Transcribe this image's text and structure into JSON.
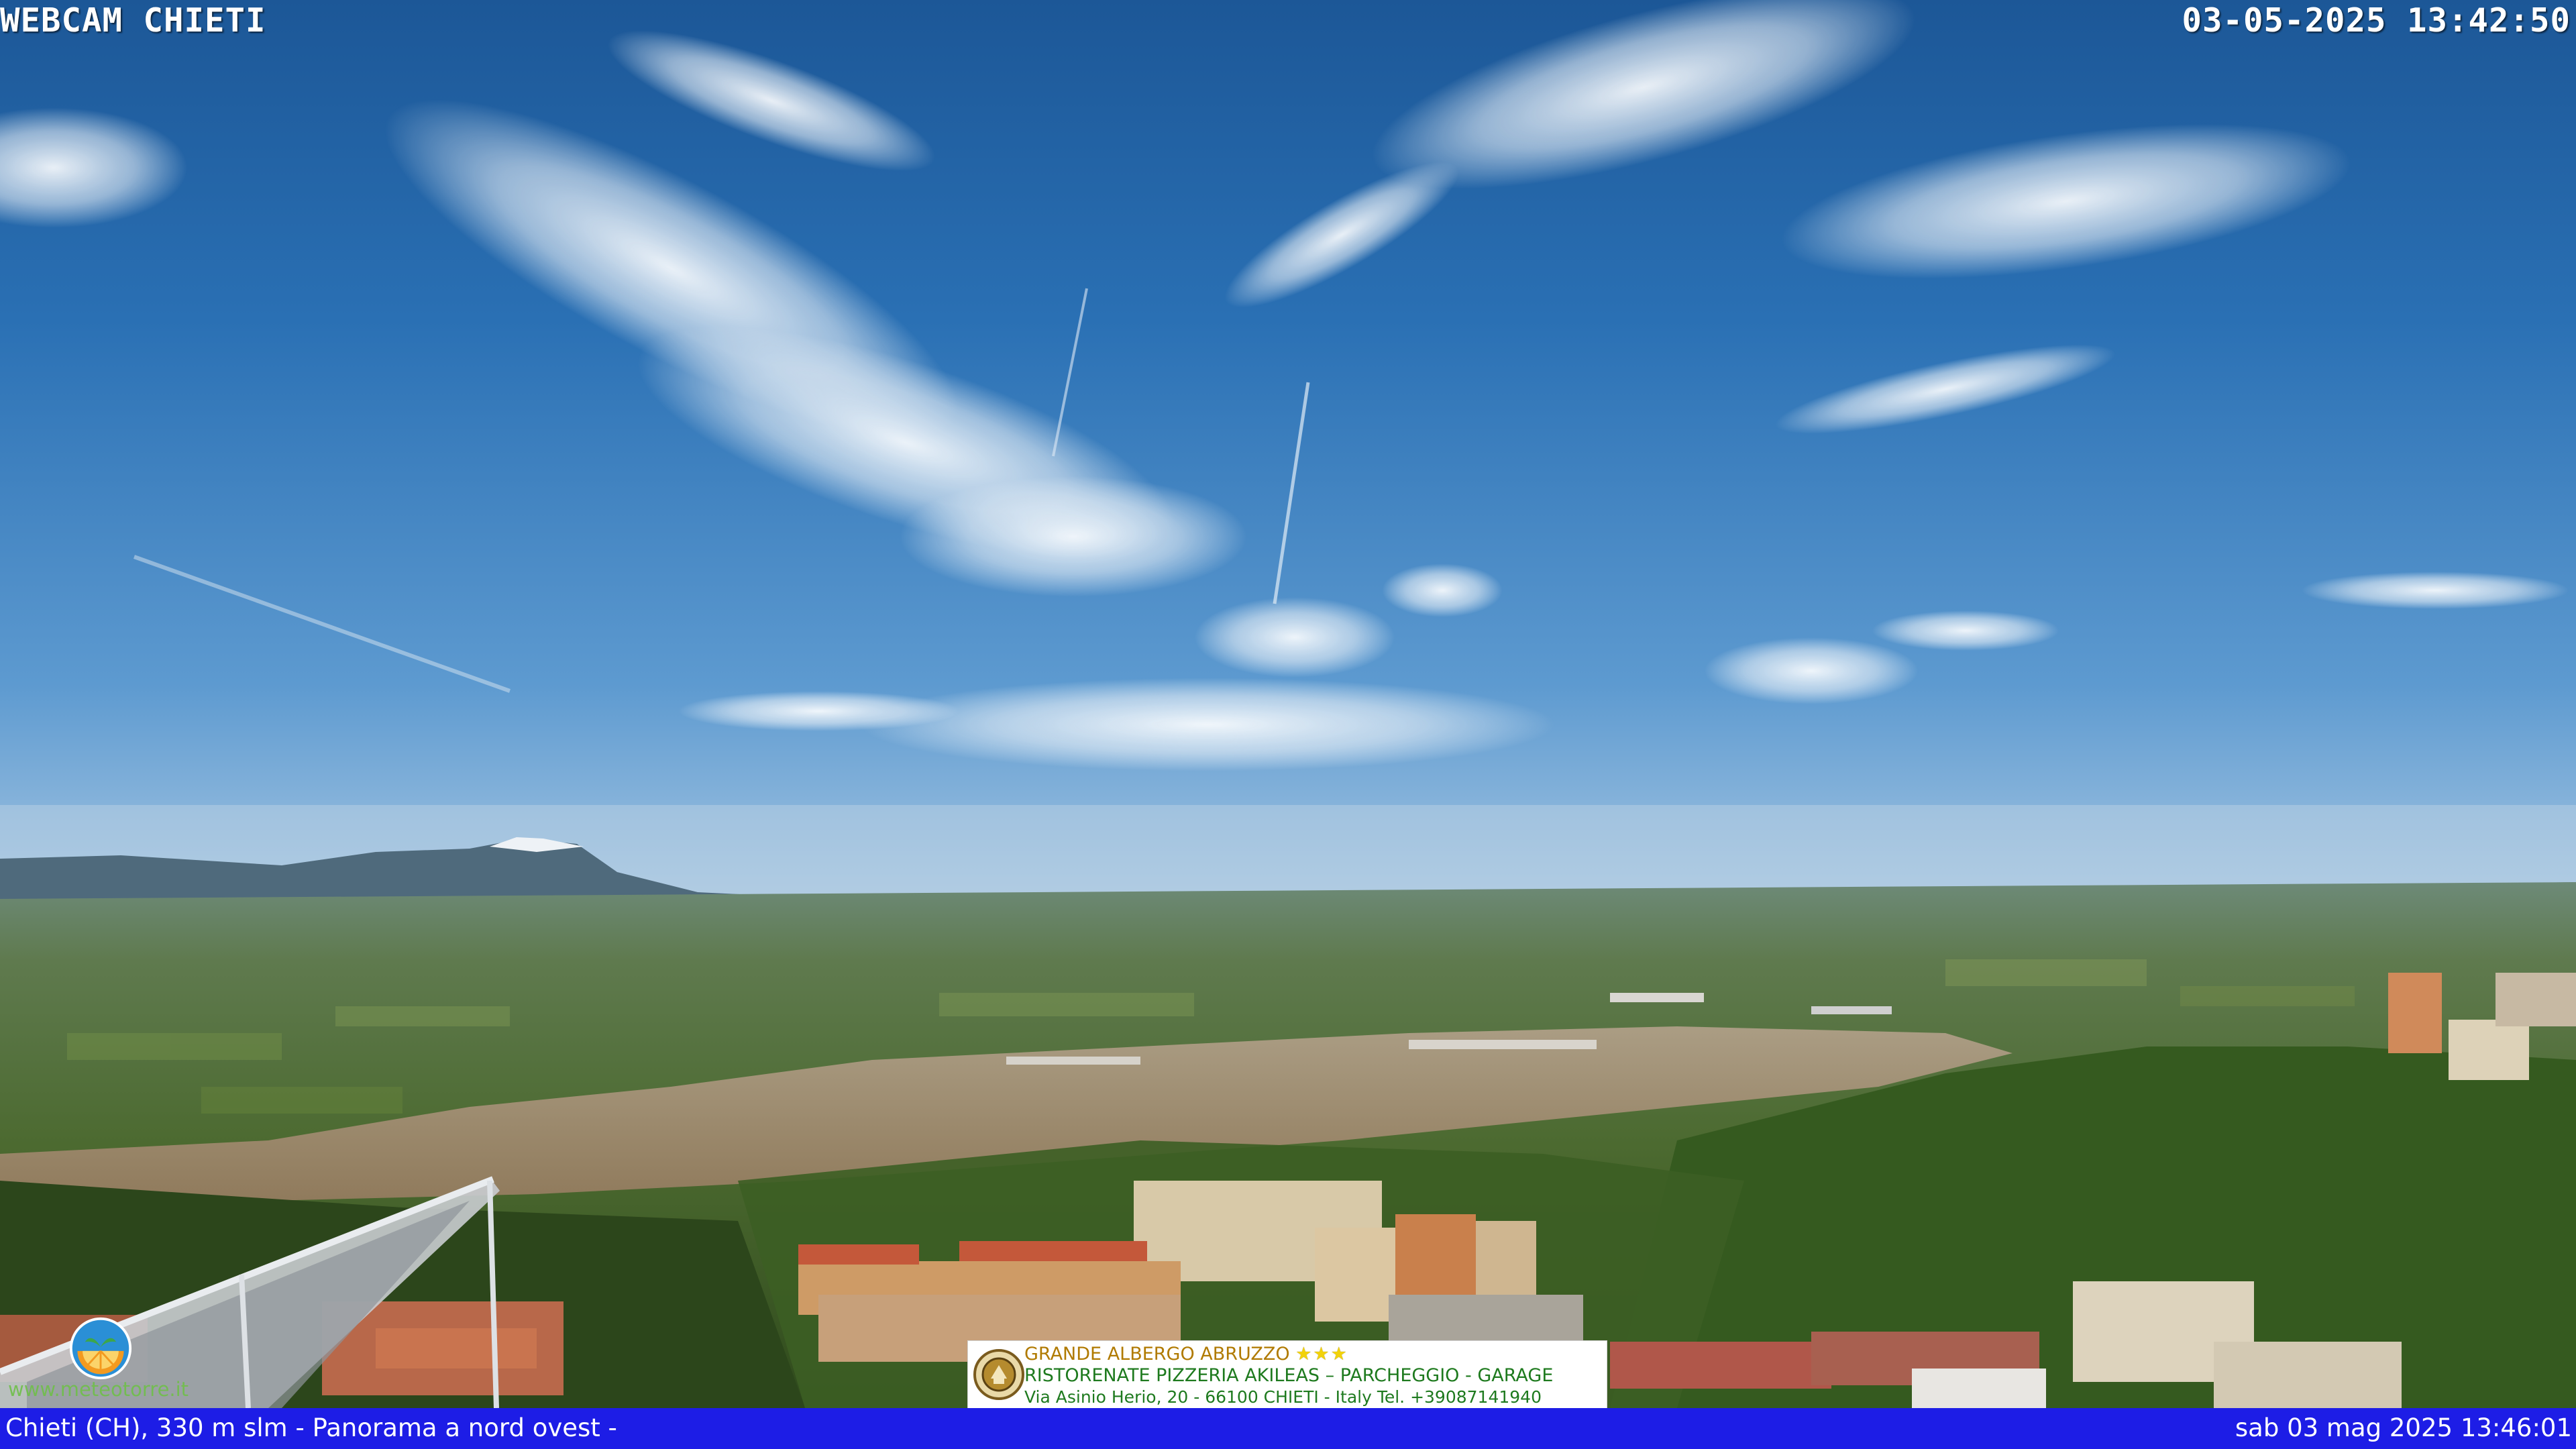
{
  "overlay": {
    "title": "WEBCAM CHIETI",
    "capture_timestamp": "03-05-2025 13:42:50"
  },
  "info_bar": {
    "location_text": "Chieti (CH), 330 m slm - Panorama a nord ovest -",
    "datetime_text": "sab 03 mag 2025 13:46:01",
    "background_color": "#1d1de6"
  },
  "advertisement": {
    "line1": "GRANDE ALBERGO ABRUZZO",
    "line1_stars": "★★★",
    "line2": "RISTORENATE PIZZERIA AKILEAS – PARCHEGGIO - GARAGE",
    "line3": "Via Asinio Herio, 20 - 66100 CHIETI - Italy Tel. +39087141940"
  },
  "watermark": {
    "url": "www.meteotorre.it",
    "logo_icon": "orange-slice-logo-icon"
  },
  "scene": {
    "description_icons": [
      "sky",
      "clouds",
      "snow-capped-mountain",
      "valley",
      "town-buildings",
      "solar-panel"
    ]
  }
}
